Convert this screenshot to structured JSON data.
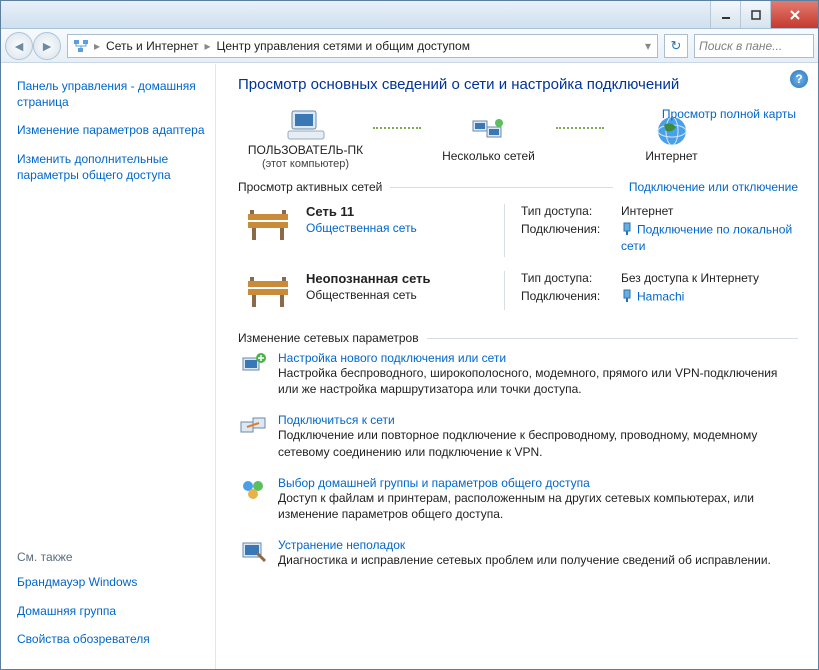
{
  "breadcrumb": {
    "level1": "Сеть и Интернет",
    "level2": "Центр управления сетями и общим доступом"
  },
  "search_placeholder": "Поиск в пане...",
  "sidebar": {
    "items": [
      "Панель управления - домашняя страница",
      "Изменение параметров адаптера",
      "Изменить дополнительные параметры общего доступа"
    ],
    "seealso_header": "См. также",
    "seealso": [
      "Брандмауэр Windows",
      "Домашняя группа",
      "Свойства обозревателя"
    ]
  },
  "main": {
    "heading": "Просмотр основных сведений о сети и настройка подключений",
    "fullmap": "Просмотр полной карты",
    "map": {
      "this_pc": "ПОЛЬЗОВАТЕЛЬ-ПК",
      "this_pc_sub": "(этот компьютер)",
      "multi": "Несколько сетей",
      "internet": "Интернет"
    },
    "active_header": "Просмотр активных сетей",
    "connect_link": "Подключение или отключение",
    "networks": [
      {
        "name": "Сеть  11",
        "category": "Общественная сеть",
        "category_link": true,
        "access_label": "Тип доступа:",
        "access_value": "Интернет",
        "conn_label": "Подключения:",
        "conn_value": "Подключение по локальной сети",
        "conn_is_link": true
      },
      {
        "name": "Неопознанная сеть",
        "category": "Общественная сеть",
        "category_link": false,
        "access_label": "Тип доступа:",
        "access_value": "Без доступа к Интернету",
        "conn_label": "Подключения:",
        "conn_value": "Hamachi",
        "conn_is_link": true
      }
    ],
    "settings_header": "Изменение сетевых параметров",
    "settings": [
      {
        "title": "Настройка нового подключения или сети",
        "desc": "Настройка беспроводного, широкополосного, модемного, прямого или VPN-подключения или же настройка маршрутизатора или точки доступа."
      },
      {
        "title": "Подключиться к сети",
        "desc": "Подключение или повторное подключение к беспроводному, проводному, модемному сетевому соединению или подключение к VPN."
      },
      {
        "title": "Выбор домашней группы и параметров общего доступа",
        "desc": "Доступ к файлам и принтерам, расположенным на других сетевых компьютерах, или изменение параметров общего доступа."
      },
      {
        "title": "Устранение неполадок",
        "desc": "Диагностика и исправление сетевых проблем или получение сведений об исправлении."
      }
    ]
  }
}
